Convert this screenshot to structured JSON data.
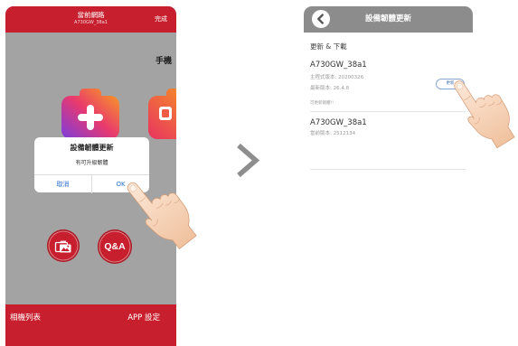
{
  "colors": {
    "brand_red": "#c81f2e",
    "header_gray": "#8c8c8c",
    "dimmed_background": "#a3a3a3",
    "link_blue": "#2a72d0"
  },
  "left_screen": {
    "header": {
      "title": "當前網路",
      "subtitle": "A730GW_38a1",
      "done_label": "完成"
    },
    "partial_heading": "手機",
    "tiles": {
      "first_icon": "add-camera-icon",
      "second_icon": "photo-camera-icon"
    },
    "dialog": {
      "title": "設備韌體更新",
      "message": "有可升級韌體",
      "cancel_label": "取消",
      "ok_label": "OK"
    },
    "shortcuts": {
      "album_icon": "album-icon",
      "qa_label": "Q&A"
    },
    "bottom_bar": {
      "left_label": "相機列表",
      "right_label": "APP 設定"
    }
  },
  "transition_icon": "chevron-right-icon",
  "pointer_icon": "pointing-hand-icon",
  "right_screen": {
    "header": {
      "back_icon": "back-icon",
      "title": "設備韌體更新"
    },
    "section_title": "更新 & 下載",
    "devices": [
      {
        "name": "A730GW_38a1",
        "lines": [
          "主程式版本: 20200326",
          "最新版本: 26.4.8"
        ],
        "update_label": "更新",
        "note": "可更新韌體!!"
      },
      {
        "name": "A730GW_38a1",
        "lines": [
          "當前版本: 2512134"
        ]
      }
    ]
  }
}
